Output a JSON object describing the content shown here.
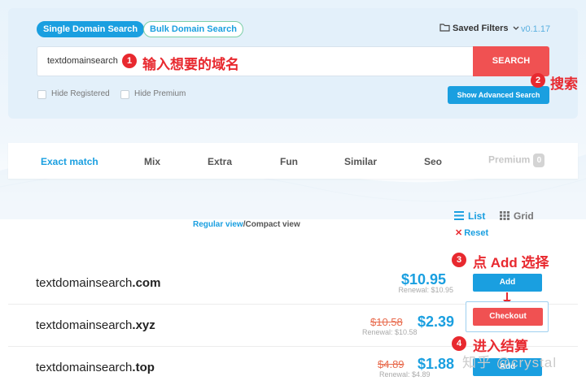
{
  "header": {
    "tabs": [
      "Single Domain Search",
      "Bulk Domain Search"
    ],
    "saved_filters": "Saved Filters",
    "version": "v0.1.17"
  },
  "search": {
    "value": "textdomainsearch",
    "button": "SEARCH",
    "hide_registered": "Hide Registered",
    "hide_premium": "Hide Premium",
    "advanced_button": "Show Advanced Search"
  },
  "annotations": {
    "n1": "1",
    "a1": "输入想要的域名",
    "n2": "2",
    "a2": "搜索",
    "n3": "3",
    "a3": "点 Add 选择",
    "n4": "4",
    "a4": "进入结算"
  },
  "result_tabs": [
    {
      "label": "Exact match",
      "active": true
    },
    {
      "label": "Mix"
    },
    {
      "label": "Extra"
    },
    {
      "label": "Fun"
    },
    {
      "label": "Similar"
    },
    {
      "label": "Seo"
    },
    {
      "label": "Premium",
      "badge": "0",
      "disabled": true
    }
  ],
  "view": {
    "regular": "Regular view",
    "separator": "/",
    "compact": "Compact view",
    "list": "List",
    "grid": "Grid",
    "reset_x": "✕",
    "reset": "Reset"
  },
  "results": [
    {
      "name": "textdomainsearch",
      "tld": ".com",
      "price": "$10.95",
      "old_price": "",
      "renewal": "Renewal: $10.95",
      "action": "Add"
    },
    {
      "name": "textdomainsearch",
      "tld": ".xyz",
      "price": "$2.39",
      "old_price": "$10.58",
      "renewal": "Renewal: $10.58",
      "action": "Checkout"
    },
    {
      "name": "textdomainsearch",
      "tld": ".top",
      "price": "$1.88",
      "old_price": "$4.89",
      "renewal": "Renewal: $4.89",
      "action": "Add"
    }
  ],
  "watermark": "知乎 @crystal",
  "colors": {
    "accent": "#1a9fe0",
    "danger": "#f05152",
    "annotation": "#e8292f"
  }
}
